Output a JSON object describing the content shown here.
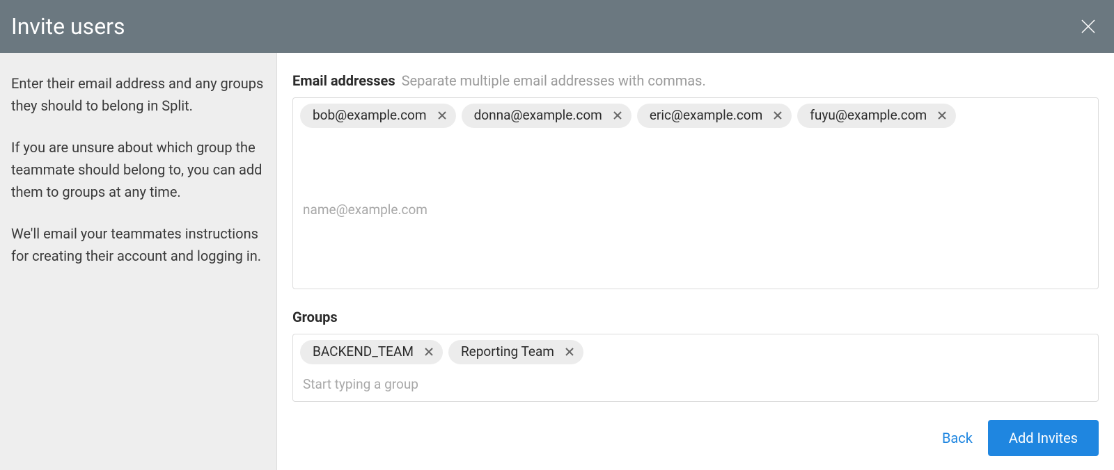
{
  "header": {
    "title": "Invite users"
  },
  "sidebar": {
    "p1": "Enter their email address and any groups they should to belong in Split.",
    "p2": "If you are unsure about which group the teammate should belong to, you can add them to groups at any time.",
    "p3": "We'll email your teammates instructions for creating their account and logging in."
  },
  "emails": {
    "label": "Email addresses",
    "hint": "Separate multiple email addresses with commas.",
    "placeholder": "name@example.com",
    "items": [
      "bob@example.com",
      "donna@example.com",
      "eric@example.com",
      "fuyu@example.com"
    ]
  },
  "groups": {
    "label": "Groups",
    "placeholder": "Start typing a group",
    "items": [
      "BACKEND_TEAM",
      "Reporting Team"
    ]
  },
  "footer": {
    "back": "Back",
    "submit": "Add Invites"
  }
}
